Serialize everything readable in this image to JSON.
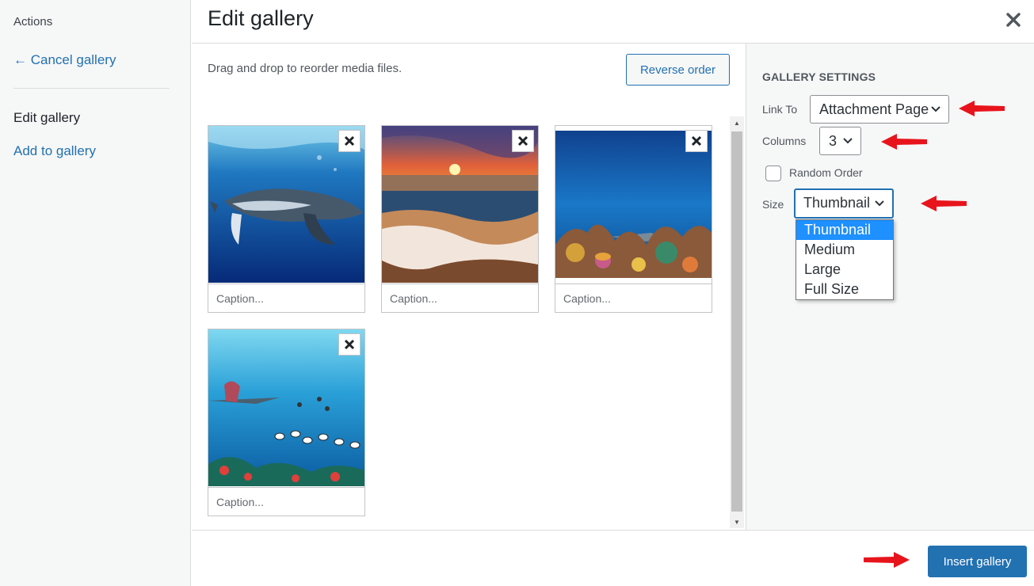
{
  "sidebar": {
    "heading": "Actions",
    "cancel_link": "← Cancel gallery",
    "current_item": "Edit gallery",
    "add_link": "Add to gallery"
  },
  "header": {
    "title": "Edit gallery",
    "close_icon": "close-icon"
  },
  "toolbar": {
    "instructions": "Drag and drop to reorder media files.",
    "reverse_label": "Reverse order"
  },
  "gallery": {
    "items": [
      {
        "image": "humpback-whale-underwater",
        "caption_placeholder": "Caption..."
      },
      {
        "image": "sunset-beach-waves",
        "caption_placeholder": "Caption..."
      },
      {
        "image": "coral-reef-shark",
        "caption_placeholder": "Caption..."
      },
      {
        "image": "reef-divers-fish",
        "caption_placeholder": "Caption..."
      }
    ]
  },
  "settings": {
    "title": "GALLERY SETTINGS",
    "link_to": {
      "label": "Link To",
      "value": "Attachment Page"
    },
    "columns": {
      "label": "Columns",
      "value": "3"
    },
    "random_order": {
      "label": "Random Order",
      "checked": false
    },
    "size": {
      "label": "Size",
      "value": "Thumbnail",
      "options": [
        "Thumbnail",
        "Medium",
        "Large",
        "Full Size"
      ]
    }
  },
  "footer": {
    "insert_label": "Insert gallery"
  },
  "colors": {
    "accent": "#2271b1",
    "annotation_arrow": "#e8141c",
    "option_highlight": "#1e90ff"
  }
}
